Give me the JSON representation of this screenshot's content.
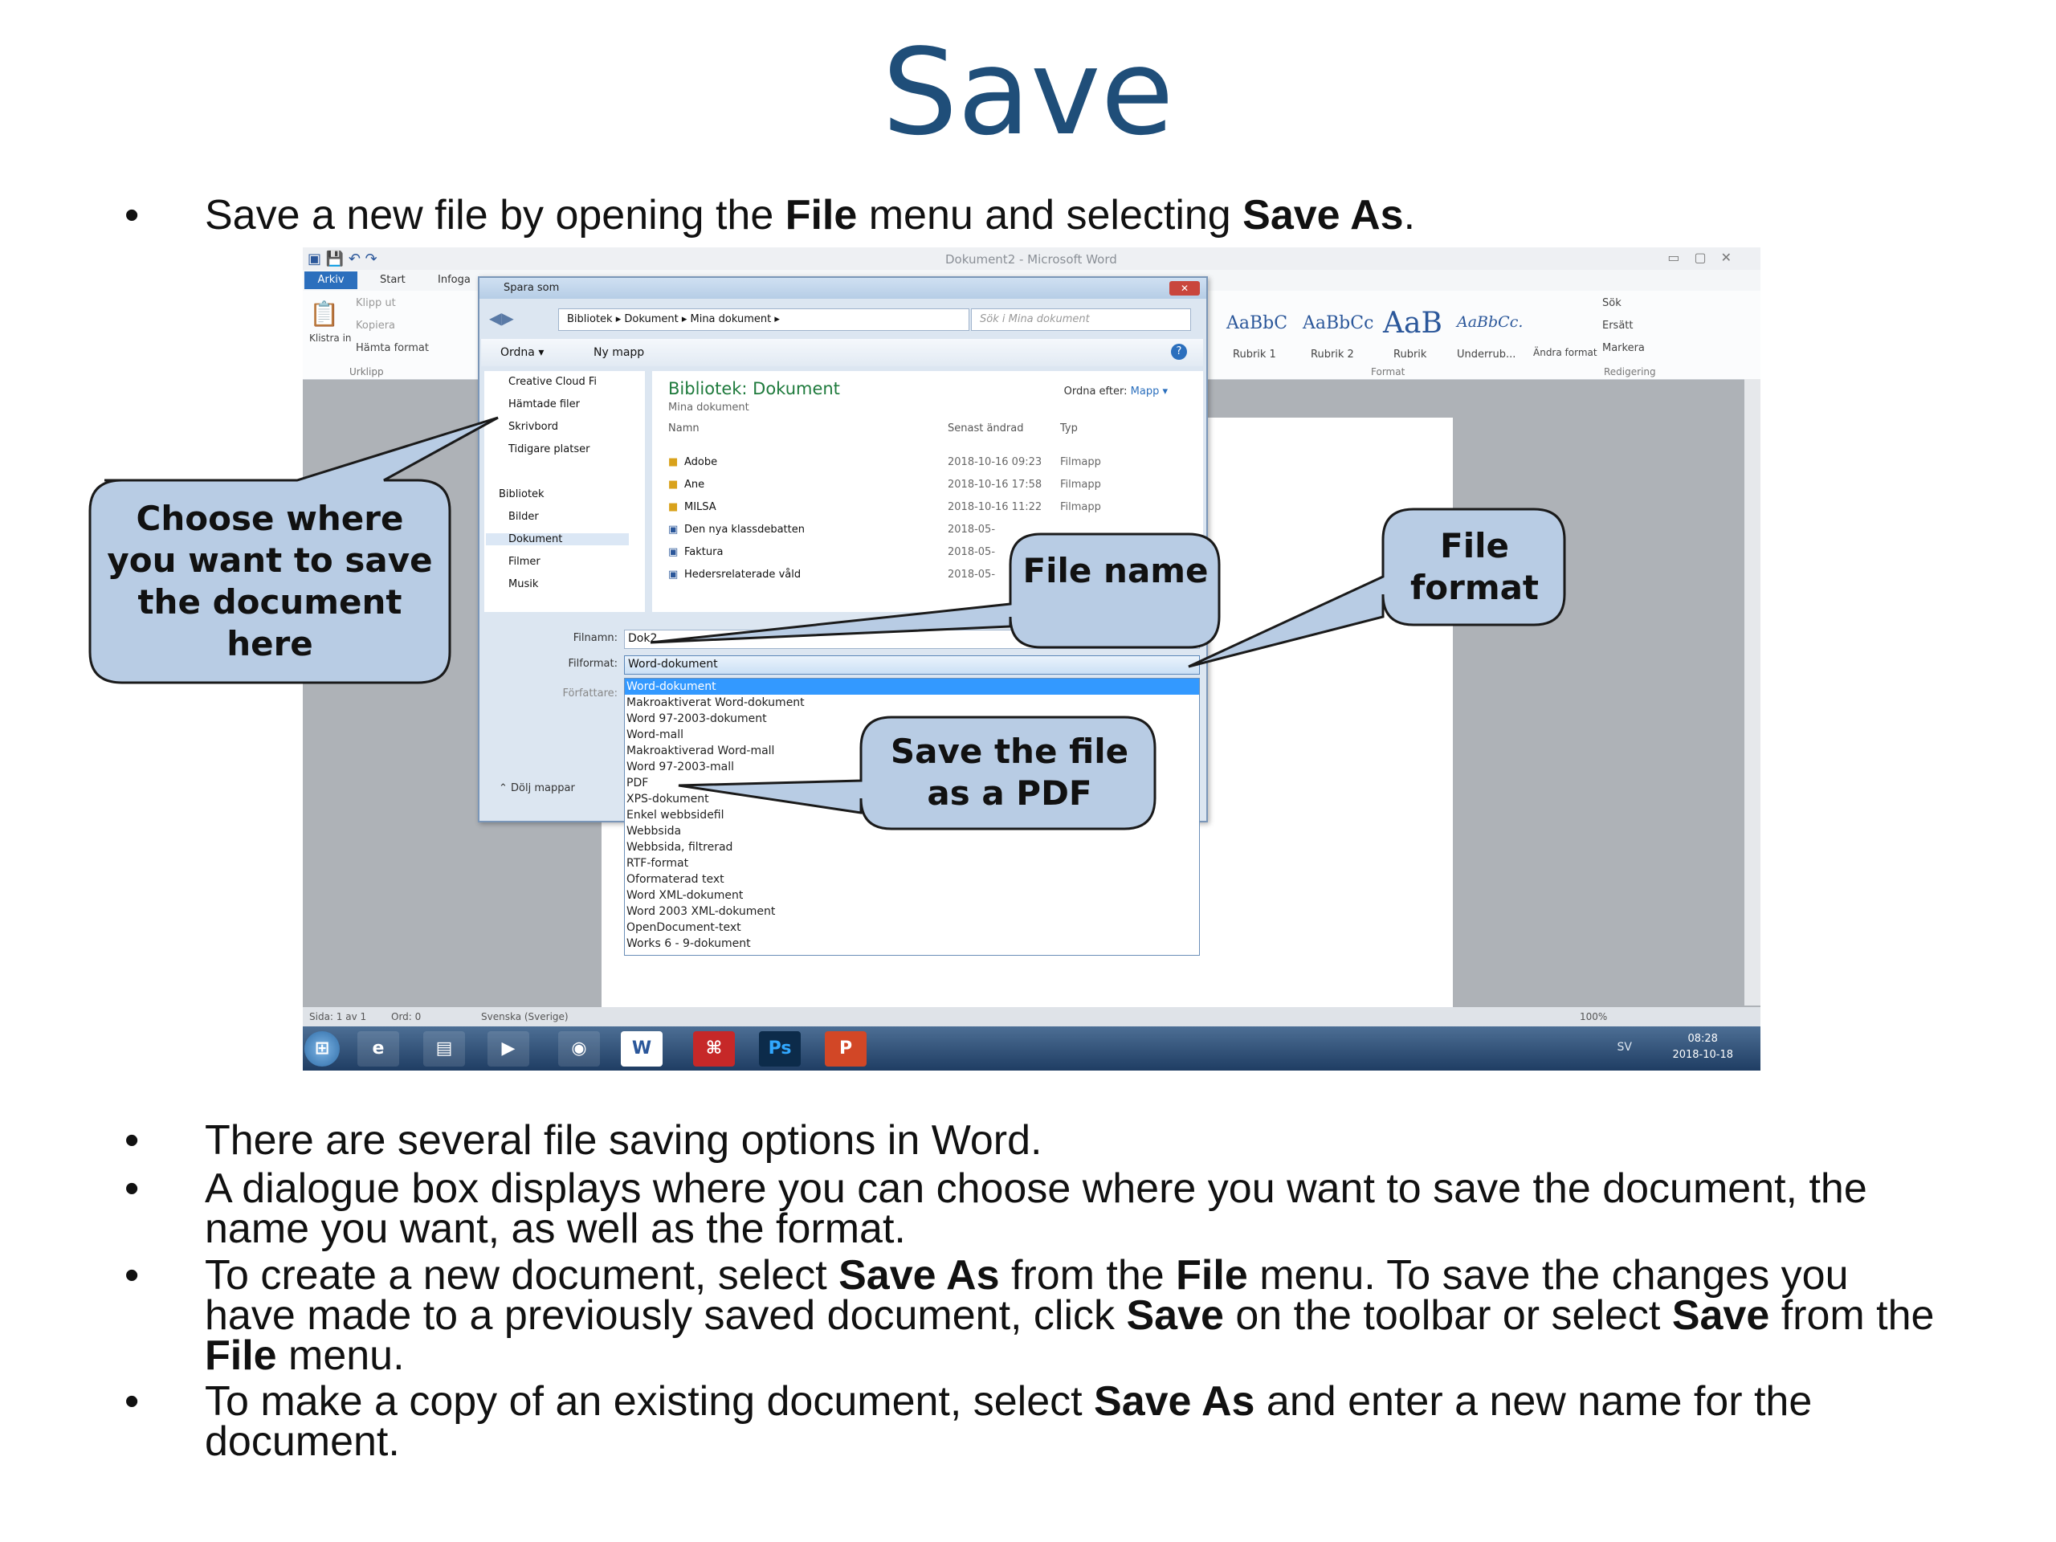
{
  "slide": {
    "title": "Save",
    "bullet_char": "•",
    "bullet1": {
      "pre": "Save a new file by opening the ",
      "b1": "File",
      "mid": " menu and selecting ",
      "b2": "Save As",
      "post": "."
    },
    "bullet2": "There are several file saving options in Word.",
    "bullet3": "A dialogue box displays where you can choose where you want to save the document, the name you want, as well as the format.",
    "bullet4": {
      "p1": "To create a new document, select ",
      "b1": "Save As",
      "p2": " from the ",
      "b2": "File",
      "p3": " menu. To save the changes you have made to a previously saved document, click ",
      "b3": "Save",
      "p4": " on the toolbar or select ",
      "b4": "Save",
      "p5": " from the ",
      "b5": "File",
      "p6": " menu."
    },
    "bullet5": {
      "p1": "To make a copy of an existing document, select ",
      "b1": "Save As",
      "p2": " and enter a new name for the document."
    }
  },
  "word": {
    "window_title": "Dokument2 - Microsoft Word",
    "tabs": {
      "arkiv": "Arkiv",
      "start": "Start",
      "infoga": "Infoga"
    },
    "clipboard": {
      "paste": "Klistra in",
      "cut": "Klipp ut",
      "copy": "Kopiera",
      "format": "Hämta format",
      "group": "Urklipp"
    },
    "styles": [
      {
        "sample": "AaBbC",
        "name": "Rubrik 1"
      },
      {
        "sample": "AaBbCc",
        "name": "Rubrik 2"
      },
      {
        "sample": "AaB",
        "name": "Rubrik"
      },
      {
        "sample": "AaBbCc.",
        "name": "Underrub..."
      }
    ],
    "change_styles": "Ändra format",
    "styles_group": "Format",
    "editing": {
      "find": "Sök",
      "replace": "Ersätt",
      "select": "Markera",
      "group": "Redigering"
    },
    "status": {
      "page": "Sida: 1 av 1",
      "words": "Ord: 0",
      "language": "Svenska (Sverige)",
      "zoom": "100%"
    },
    "taskbar_apps": [
      "start",
      "ie",
      "explorer",
      "media",
      "chrome",
      "W",
      "acrobat",
      "Ps",
      "P"
    ],
    "tray": {
      "lang": "SV",
      "time": "08:28",
      "date": "2018-10-18"
    }
  },
  "dialog": {
    "title": "Spara som",
    "address": "Bibliotek ▸ Dokument ▸ Mina dokument ▸",
    "search_placeholder": "Sök i Mina dokument",
    "organize": "Ordna ▾",
    "new_folder": "Ny mapp",
    "nav": [
      "Creative Cloud Fi",
      "Hämtade filer",
      "Skrivbord",
      "Tidigare platser",
      "Bibliotek",
      "Bilder",
      "Dokument",
      "Filmer",
      "Musik"
    ],
    "library_title": "Bibliotek: Dokument",
    "library_sub": "Mina dokument",
    "arrange_label": "Ordna efter:",
    "arrange_value": "Mapp ▾",
    "columns": {
      "name": "Namn",
      "modified": "Senast ändrad",
      "type": "Typ"
    },
    "files": [
      {
        "name": "Adobe",
        "date": "2018-10-16 09:23",
        "type": "Filmapp"
      },
      {
        "name": "Ane",
        "date": "2018-10-16 17:58",
        "type": "Filmapp"
      },
      {
        "name": "MILSA",
        "date": "2018-10-16 11:22",
        "type": "Filmapp"
      },
      {
        "name": "Den nya klassdebatten",
        "date": "2018-05-",
        "type": ""
      },
      {
        "name": "Faktura",
        "date": "2018-05-",
        "type": ""
      },
      {
        "name": "Hedersrelaterade våld",
        "date": "2018-05-",
        "type": ""
      }
    ],
    "filename_label": "Filnamn:",
    "filename_value": "Dok2",
    "format_label": "Filformat:",
    "format_value": "Word-dokument",
    "author_label": "Författare:",
    "hide_folders": "Dölj mappar",
    "formats": [
      "Word-dokument",
      "Makroaktiverat Word-dokument",
      "Word 97-2003-dokument",
      "Word-mall",
      "Makroaktiverad Word-mall",
      "Word 97-2003-mall",
      "PDF",
      "XPS-dokument",
      "Enkel webbsidefil",
      "Webbsida",
      "Webbsida, filtrerad",
      "RTF-format",
      "Oformaterad text",
      "Word XML-dokument",
      "Word 2003 XML-dokument",
      "OpenDocument-text",
      "Works 6 - 9-dokument"
    ]
  },
  "callouts": {
    "location": "Choose where you want to save the document here",
    "name": "File name",
    "format": "File format",
    "pdf": "Save the file as a PDF"
  },
  "colors": {
    "title": "#1f4e79",
    "callout_fill": "#b8cce4",
    "callout_stroke": "#1a1a1a",
    "selected": "#3399ff"
  }
}
